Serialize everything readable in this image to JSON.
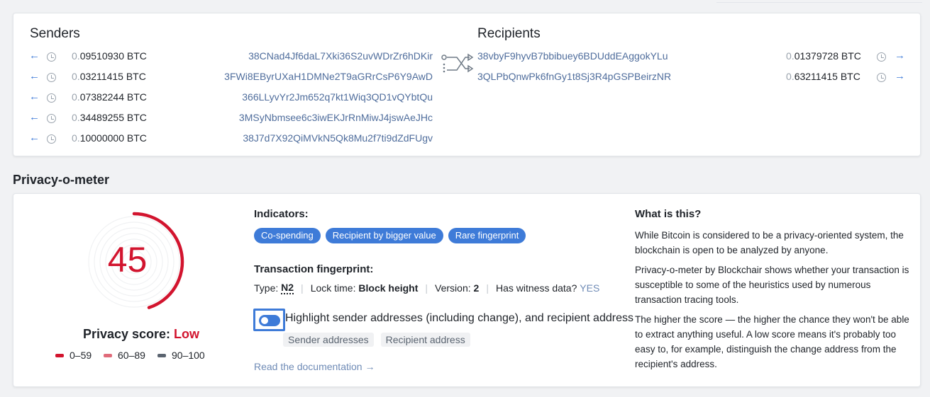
{
  "senders": {
    "title": "Senders",
    "rows": [
      {
        "amount_dim": "0.",
        "amount_main": "09510930",
        "unit": "BTC",
        "address": "38CNad4Jf6daL7Xki36S2uvWDrZr6hDKir"
      },
      {
        "amount_dim": "0.",
        "amount_main": "03211415",
        "unit": "BTC",
        "address": "3FWi8EByrUXaH1DMNe2T9aGRrCsP6Y9AwD"
      },
      {
        "amount_dim": "0.",
        "amount_main": "07382244",
        "unit": "BTC",
        "address": "366LLyvYr2Jm652q7kt1Wiq3QD1vQYbtQu"
      },
      {
        "amount_dim": "0.",
        "amount_main": "34489255",
        "unit": "BTC",
        "address": "3MSyNbmsee6c3iwEKJrRnMiwJ4jswAeJHc"
      },
      {
        "amount_dim": "0.",
        "amount_main": "10000000",
        "unit": "BTC",
        "address": "38J7d7X92QiMVkN5Qk8Mu2f7ti9dZdFUgv"
      }
    ]
  },
  "recipients": {
    "title": "Recipients",
    "rows": [
      {
        "amount_dim": "0.",
        "amount_main": "01379728",
        "unit": "BTC",
        "address": "38vbyF9hyvB7bbibuey6BDUddEAggokYLu"
      },
      {
        "amount_dim": "0.",
        "amount_main": "63211415",
        "unit": "BTC",
        "address": "3QLPbQnwPk6fnGy1t8Sj3R4pGSPBeirzNR"
      }
    ]
  },
  "privacy": {
    "section_title": "Privacy-o-meter",
    "score": "45",
    "score_fraction": 0.45,
    "score_label": "Privacy score:",
    "score_level": "Low",
    "legend": [
      {
        "range": "0–59",
        "color": "#d2142e"
      },
      {
        "range": "60–89",
        "color": "#e06b7a"
      },
      {
        "range": "90–100",
        "color": "#5b6470"
      }
    ],
    "indicators_title": "Indicators:",
    "indicators": [
      "Co-spending",
      "Recipient by bigger value",
      "Rare fingerprint"
    ],
    "fingerprint_title": "Transaction fingerprint:",
    "fingerprint": {
      "type_label": "Type:",
      "type_value": "N2",
      "lock_label": "Lock time:",
      "lock_value": "Block height",
      "version_label": "Version:",
      "version_value": "2",
      "witness_label": "Has witness data?",
      "witness_value": "YES"
    },
    "highlight_label": "Highlight sender addresses (including change), and recipient address",
    "chips": [
      "Sender addresses",
      "Recipient address"
    ],
    "doc_link": "Read the documentation →",
    "what_title": "What is this?",
    "paragraphs": [
      "While Bitcoin is considered to be a privacy-oriented system, the blockchain is open to be analyzed by anyone.",
      "Privacy-o-meter by Blockchair shows whether your transaction is susceptible to some of the heuristics used by numerous transaction tracing tools.",
      "The higher the score — the higher the chance they won't be able to extract anything useful. A low score means it's probably too easy to, for example, distinguish the change address from the recipient's address."
    ]
  },
  "colors": {
    "accent": "#3e7bd8",
    "danger": "#d2142e",
    "address": "#4f6d9c"
  }
}
